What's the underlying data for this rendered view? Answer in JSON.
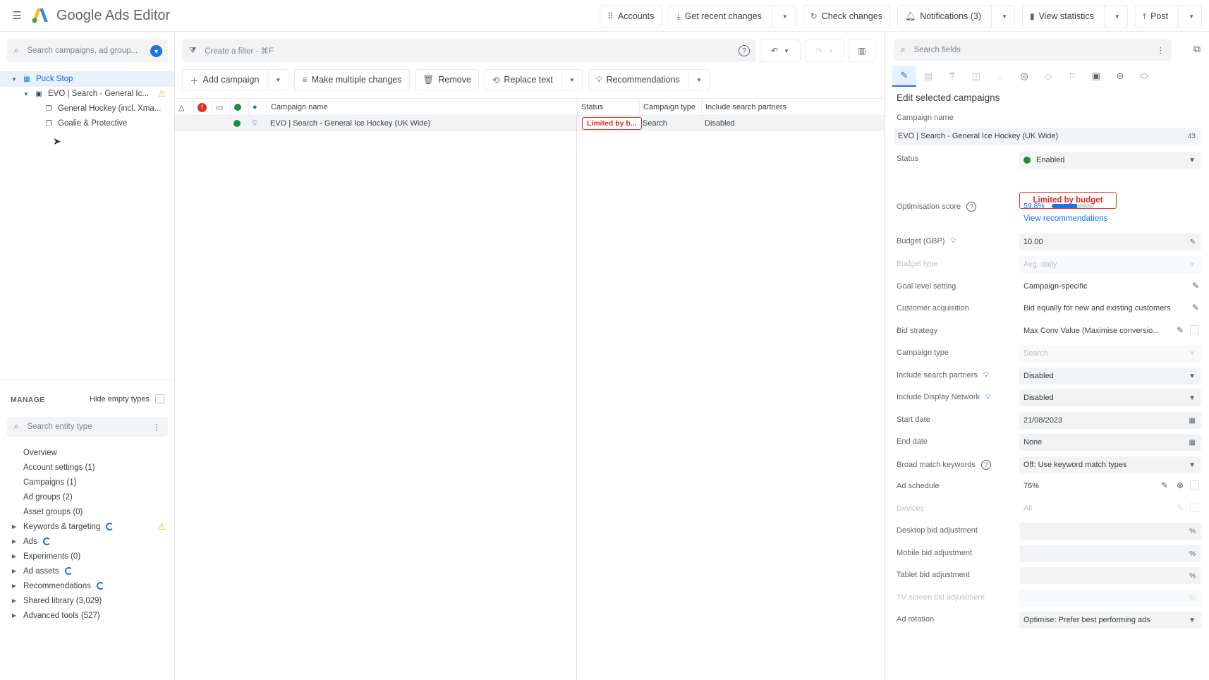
{
  "app": {
    "title": "Google Ads Editor"
  },
  "toolbar": {
    "accounts": "Accounts",
    "get_recent": "Get recent changes",
    "check_changes": "Check changes",
    "notifications": "Notifications (3)",
    "view_statistics": "View statistics",
    "post": "Post"
  },
  "left": {
    "search_placeholder": "Search campaigns, ad group...",
    "tree": [
      {
        "label": "Puck Stop"
      },
      {
        "label": "EVO | Search - General Ic..."
      },
      {
        "label": "General Hockey (incl. Xma..."
      },
      {
        "label": "Goalie & Protective"
      }
    ],
    "manage_title": "MANAGE",
    "hide_empty": "Hide empty types",
    "entity_search_placeholder": "Search entity type",
    "items": [
      {
        "label": "Overview"
      },
      {
        "label": "Account settings (1)"
      },
      {
        "label": "Campaigns (1)"
      },
      {
        "label": "Ad groups (2)"
      },
      {
        "label": "Asset groups (0)"
      },
      {
        "label": "Keywords & targeting"
      },
      {
        "label": "Ads"
      },
      {
        "label": "Experiments (0)"
      },
      {
        "label": "Ad assets"
      },
      {
        "label": "Recommendations"
      },
      {
        "label": "Shared library (3,029)"
      },
      {
        "label": "Advanced tools (527)"
      }
    ]
  },
  "center": {
    "filter_placeholder": "Create a filter - ⌘F",
    "actions": {
      "add_campaign": "Add campaign",
      "make_multiple": "Make multiple changes",
      "remove": "Remove",
      "replace_text": "Replace text",
      "recommendations": "Recommendations"
    },
    "columns": {
      "name": "Campaign name",
      "status": "Status",
      "type": "Campaign type",
      "partners": "Include search partners"
    },
    "rows": [
      {
        "name": "EVO | Search - General Ice Hockey (UK Wide)",
        "status": "Limited by b...",
        "type": "Search",
        "partners": "Disabled"
      }
    ]
  },
  "right": {
    "search_placeholder": "Search fields",
    "heading": "Edit selected campaigns",
    "campaign_name_label": "Campaign name",
    "campaign_name": "EVO | Search - General Ice Hockey (UK Wide)",
    "campaign_name_count": "43",
    "status_label": "Status",
    "status_value": "Enabled",
    "limited_badge": "Limited by budget",
    "opt_label": "Optimisation score",
    "opt_value": "59.8%",
    "opt_fraction": 0.598,
    "view_recs": "View recommendations",
    "budget_label": "Budget (GBP)",
    "budget_value": "10.00",
    "budget_type_label": "Budget type",
    "budget_type_value": "Avg. daily",
    "goal_label": "Goal level setting",
    "goal_value": "Campaign-specific",
    "acq_label": "Customer acquisition",
    "acq_value": "Bid equally for new and existing customers",
    "bid_label": "Bid strategy",
    "bid_value": "Max Conv Value (Maximise conversio...",
    "ctype_label": "Campaign type",
    "ctype_value": "Search",
    "partners_label": "Include search partners",
    "partners_value": "Disabled",
    "display_label": "Include Display Network",
    "display_value": "Disabled",
    "start_label": "Start date",
    "start_value": "21/08/2023",
    "end_label": "End date",
    "end_value": "None",
    "broad_label": "Broad match keywords",
    "broad_value": "Off: Use keyword match types",
    "schedule_label": "Ad schedule",
    "schedule_value": "76%",
    "devices_label": "Devices",
    "devices_value": "All",
    "desktop_label": "Desktop bid adjustment",
    "mobile_label": "Mobile bid adjustment",
    "tablet_label": "Tablet bid adjustment",
    "tv_label": "TV screen bid adjustment",
    "pct": "%",
    "rotation_label": "Ad rotation",
    "rotation_value": "Optimise: Prefer best performing ads"
  },
  "colors": {
    "accent": "#1a73e8",
    "error": "#d93025",
    "enabled": "#1e8e3e",
    "warning": "#f9ab00"
  }
}
